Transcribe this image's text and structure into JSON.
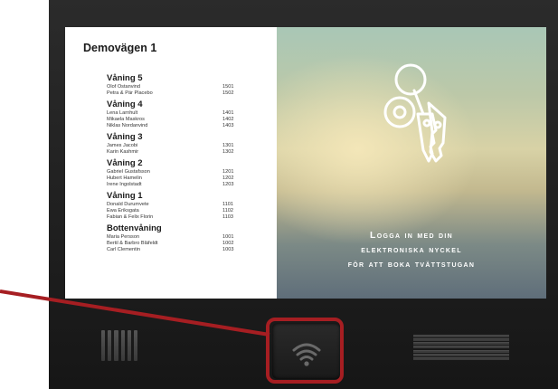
{
  "building_name": "Demovägen 1",
  "floors": [
    {
      "title": "Våning 5",
      "residents": [
        {
          "name": "Olof Ostanvind",
          "apt": "1501"
        },
        {
          "name": "Petra & Pär Placebo",
          "apt": "1502"
        }
      ]
    },
    {
      "title": "Våning 4",
      "residents": [
        {
          "name": "Lena Larnhult",
          "apt": "1401"
        },
        {
          "name": "Mikaela Maskros",
          "apt": "1402"
        },
        {
          "name": "Niklas Nordanvind",
          "apt": "1403"
        }
      ]
    },
    {
      "title": "Våning 3",
      "residents": [
        {
          "name": "James Jacobi",
          "apt": "1301"
        },
        {
          "name": "Karin Kashmir",
          "apt": "1302"
        }
      ]
    },
    {
      "title": "Våning 2",
      "residents": [
        {
          "name": "Gabriel Gustafsson",
          "apt": "1201"
        },
        {
          "name": "Hubert Hamelin",
          "apt": "1202"
        },
        {
          "name": "Irene Ingolstadt",
          "apt": "1203"
        }
      ]
    },
    {
      "title": "Våning 1",
      "residents": [
        {
          "name": "Donald Durumvete",
          "apt": "1101"
        },
        {
          "name": "Ewa Eriksgata",
          "apt": "1102"
        },
        {
          "name": "Fabian & Felix Florin",
          "apt": "1103"
        }
      ]
    },
    {
      "title": "Bottenvåning",
      "residents": [
        {
          "name": "Maria Persson",
          "apt": "1001"
        },
        {
          "name": "Bertil & Barbro Bläfeldt",
          "apt": "1002"
        },
        {
          "name": "Carl Clementin",
          "apt": "1003"
        }
      ]
    }
  ],
  "login_message": [
    "Logga in med din",
    "elektroniska nyckel",
    "för att boka tvättstugan"
  ],
  "icons": {
    "keys": "keys-icon",
    "nfc": "wifi-icon"
  },
  "colors": {
    "highlight": "#a61e22",
    "device": "#1f1f1f"
  }
}
